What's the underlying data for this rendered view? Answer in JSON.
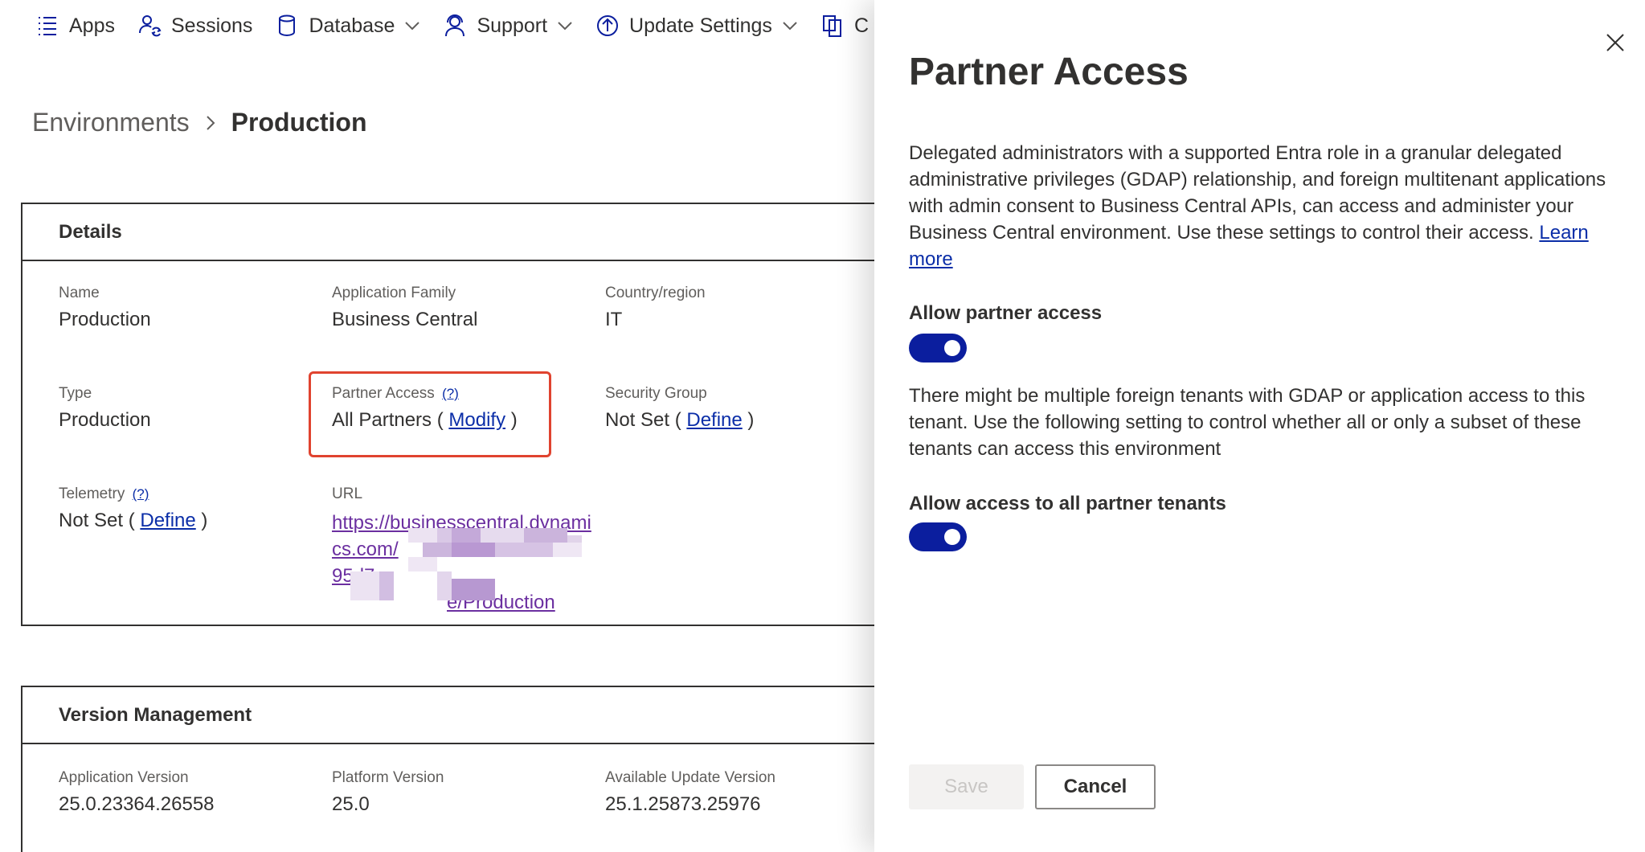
{
  "commandbar": {
    "items": [
      {
        "label": "Apps"
      },
      {
        "label": "Sessions"
      },
      {
        "label": "Database"
      },
      {
        "label": "Support"
      },
      {
        "label": "Update Settings"
      },
      {
        "label": "C"
      }
    ]
  },
  "breadcrumb": {
    "root": "Environments",
    "current": "Production"
  },
  "details": {
    "header": "Details",
    "name": {
      "label": "Name",
      "value": "Production"
    },
    "app_family": {
      "label": "Application Family",
      "value": "Business Central"
    },
    "country": {
      "label": "Country/region",
      "value": "IT"
    },
    "type": {
      "label": "Type",
      "value": "Production"
    },
    "partner_access": {
      "label": "Partner Access",
      "help": "(?)",
      "value_prefix": "All Partners (",
      "link": "Modify",
      "value_suffix": ")"
    },
    "security_group": {
      "label": "Security Group",
      "value_prefix": "Not Set (",
      "link": "Define",
      "value_suffix": ")"
    },
    "telemetry": {
      "label": "Telemetry",
      "help": "(?)",
      "value_prefix": "Not Set (",
      "link": "Define",
      "value_suffix": ")"
    },
    "url": {
      "label": "URL",
      "line1": "https://businesscentral.dynami",
      "line2": "cs.com/",
      "line3": "95d7",
      "line4": "e/Production"
    }
  },
  "version": {
    "header": "Version Management",
    "app_version": {
      "label": "Application Version",
      "value": "25.0.23364.26558"
    },
    "platform_version": {
      "label": "Platform Version",
      "value": "25.0"
    },
    "available_update": {
      "label": "Available Update Version",
      "value": "25.1.25873.25976"
    }
  },
  "panel": {
    "title": "Partner Access",
    "description": "Delegated administrators with a supported Entra role in a granular delegated administrative privileges (GDAP) relationship, and foreign multitenant applications with admin consent to Business Central APIs, can access and administer your Business Central environment. Use these settings to control their access.",
    "learn_more": "Learn more",
    "allow_partner_access": {
      "label": "Allow partner access",
      "on": true
    },
    "note": "There might be multiple foreign tenants with GDAP or application access to this tenant. Use the following setting to control whether all or only a subset of these tenants can access this environment",
    "allow_all_tenants": {
      "label": "Allow access to all partner tenants",
      "on": true
    },
    "save_label": "Save",
    "cancel_label": "Cancel"
  },
  "colors": {
    "accent": "#0b1e9e",
    "link": "#0b2ea8",
    "highlight": "#e0432f",
    "visited_link": "#6b2fa0"
  }
}
